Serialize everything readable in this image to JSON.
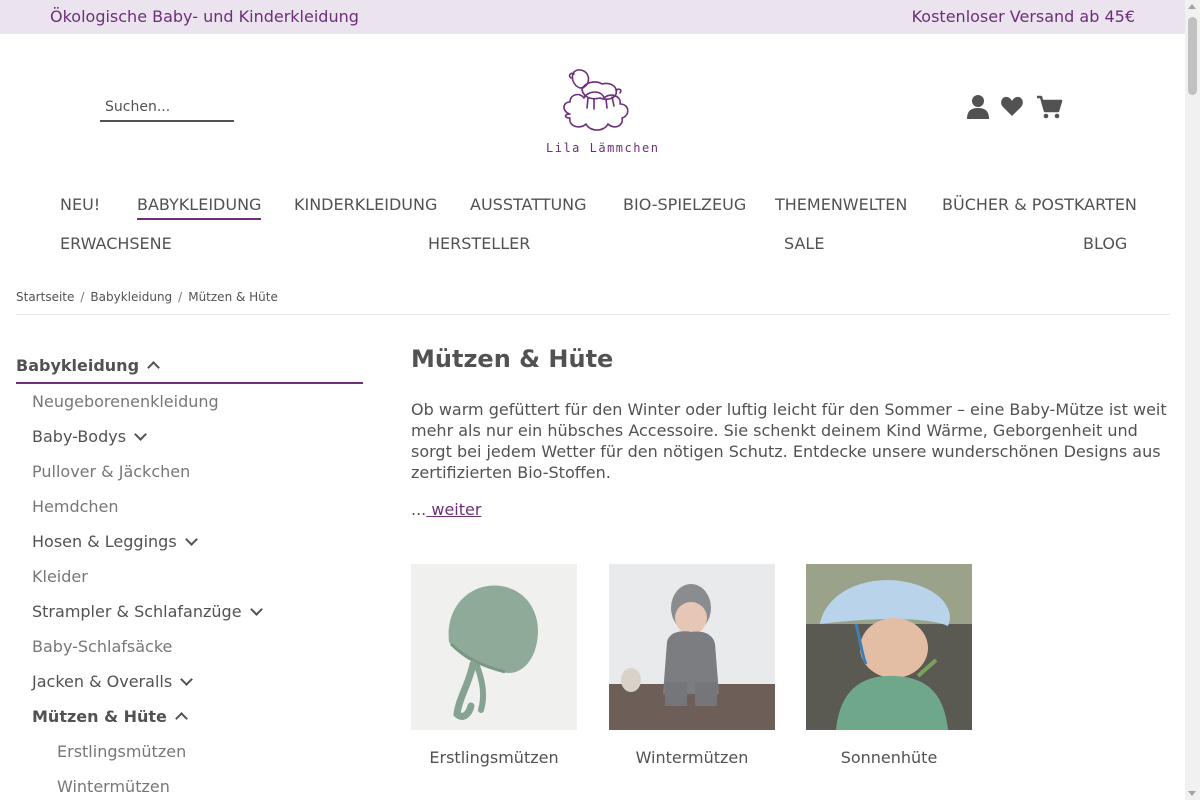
{
  "topbar": {
    "left": "Ökologische Baby- und Kinderkleidung",
    "right": "Kostenloser Versand ab 45€"
  },
  "search": {
    "placeholder": "Suchen..."
  },
  "logo": {
    "name": "Lila Lämmchen"
  },
  "header_icons": [
    "user-icon",
    "heart-icon",
    "cart-icon"
  ],
  "nav": {
    "row1": [
      "NEU!",
      "BABYKLEIDUNG",
      "KINDERKLEIDUNG",
      "AUSSTATTUNG",
      "BIO-SPIELZEUG",
      "THEMENWELTEN",
      "BÜCHER & POSTKARTEN"
    ],
    "row2": [
      "ERWACHSENE",
      "HERSTELLER",
      "SALE",
      "BLOG"
    ],
    "active": "BABYKLEIDUNG"
  },
  "breadcrumb": [
    "Startseite",
    "Babykleidung",
    "Mützen & Hüte"
  ],
  "sidebar": {
    "heading": "Babykleidung",
    "items": [
      {
        "label": "Neugeborenenkleidung",
        "expandable": false
      },
      {
        "label": "Baby-Bodys",
        "expandable": true
      },
      {
        "label": "Pullover & Jäckchen",
        "expandable": false
      },
      {
        "label": "Hemdchen",
        "expandable": false
      },
      {
        "label": "Hosen & Leggings",
        "expandable": true
      },
      {
        "label": "Kleider",
        "expandable": false
      },
      {
        "label": "Strampler & Schlafanzüge",
        "expandable": true
      },
      {
        "label": "Baby-Schlafsäcke",
        "expandable": false
      },
      {
        "label": "Jacken & Overalls",
        "expandable": true
      },
      {
        "label": "Mützen & Hüte",
        "expandable": true,
        "open": true
      },
      {
        "label": "Erstlingsmützen",
        "sub": true
      },
      {
        "label": "Wintermützen",
        "sub": true
      }
    ]
  },
  "content": {
    "title": "Mützen & Hüte",
    "description": "Ob warm gefüttert für den Winter oder luftig leicht für den Sommer – eine Baby-Mütze ist weit mehr als nur ein hübsches Accessoire. Sie schenkt deinem Kind Wärme, Geborgenheit und sorgt bei jedem Wetter für den nötigen Schutz. Entdecke unsere wunderschönen Designs aus zertifizierten Bio-Stoffen.",
    "more_prefix": "...",
    "more_link": " weiter"
  },
  "tiles": [
    {
      "label": "Erstlingsmützen"
    },
    {
      "label": "Wintermützen"
    },
    {
      "label": "Sonnenhüte"
    }
  ],
  "colors": {
    "accent": "#6d2f7a",
    "topbar_bg": "#ebe4ee",
    "text": "#525252"
  }
}
